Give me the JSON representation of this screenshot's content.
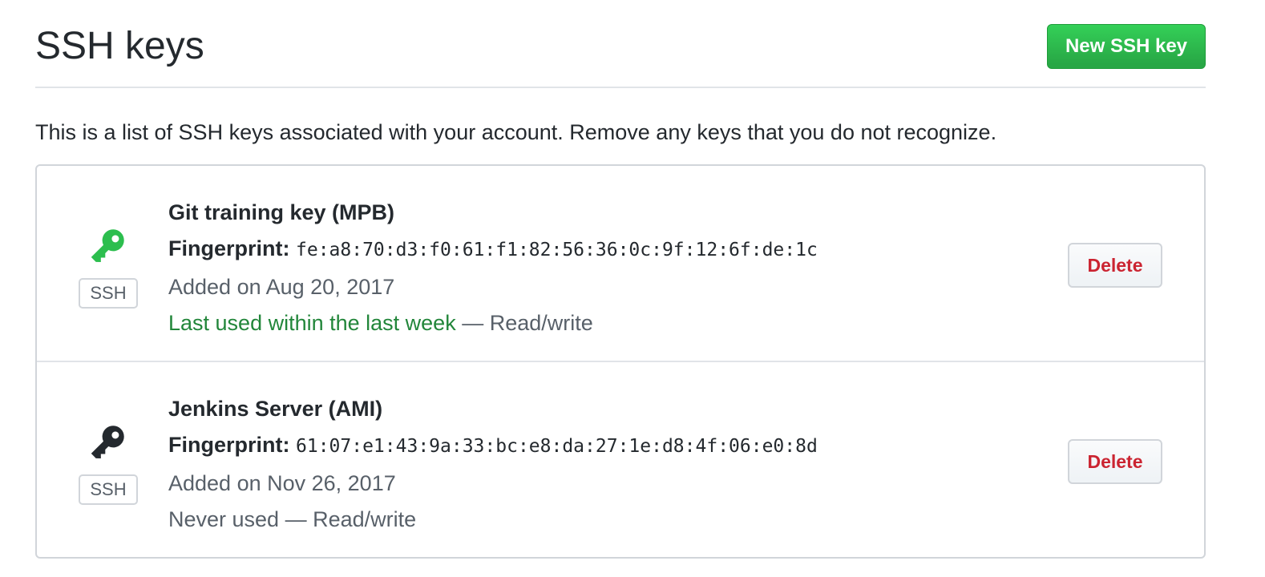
{
  "header": {
    "title": "SSH keys",
    "new_key_label": "New SSH key"
  },
  "description": "This is a list of SSH keys associated with your account. Remove any keys that you do not recognize.",
  "keys": [
    {
      "icon": "key-icon",
      "icon_color": "#2cbe4e",
      "badge": "SSH",
      "title": "Git training key (MPB)",
      "fingerprint_label": "Fingerprint:",
      "fingerprint": "fe:a8:70:d3:f0:61:f1:82:56:36:0c:9f:12:6f:de:1c",
      "added": "Added on Aug 20, 2017",
      "usage": "Last used within the last week",
      "usage_color": "#22863a",
      "access": " — Read/write",
      "delete_label": "Delete"
    },
    {
      "icon": "key-icon",
      "icon_color": "#24292e",
      "badge": "SSH",
      "title": "Jenkins Server (AMI)",
      "fingerprint_label": "Fingerprint:",
      "fingerprint": "61:07:e1:43:9a:33:bc:e8:da:27:1e:d8:4f:06:e0:8d",
      "added": "Added on Nov 26, 2017",
      "usage": "Never used",
      "usage_color": "#586069",
      "access": " — Read/write",
      "delete_label": "Delete"
    }
  ],
  "colors": {
    "primary_button": "#28a745",
    "danger_text": "#cb2431",
    "border": "#d1d5da"
  }
}
